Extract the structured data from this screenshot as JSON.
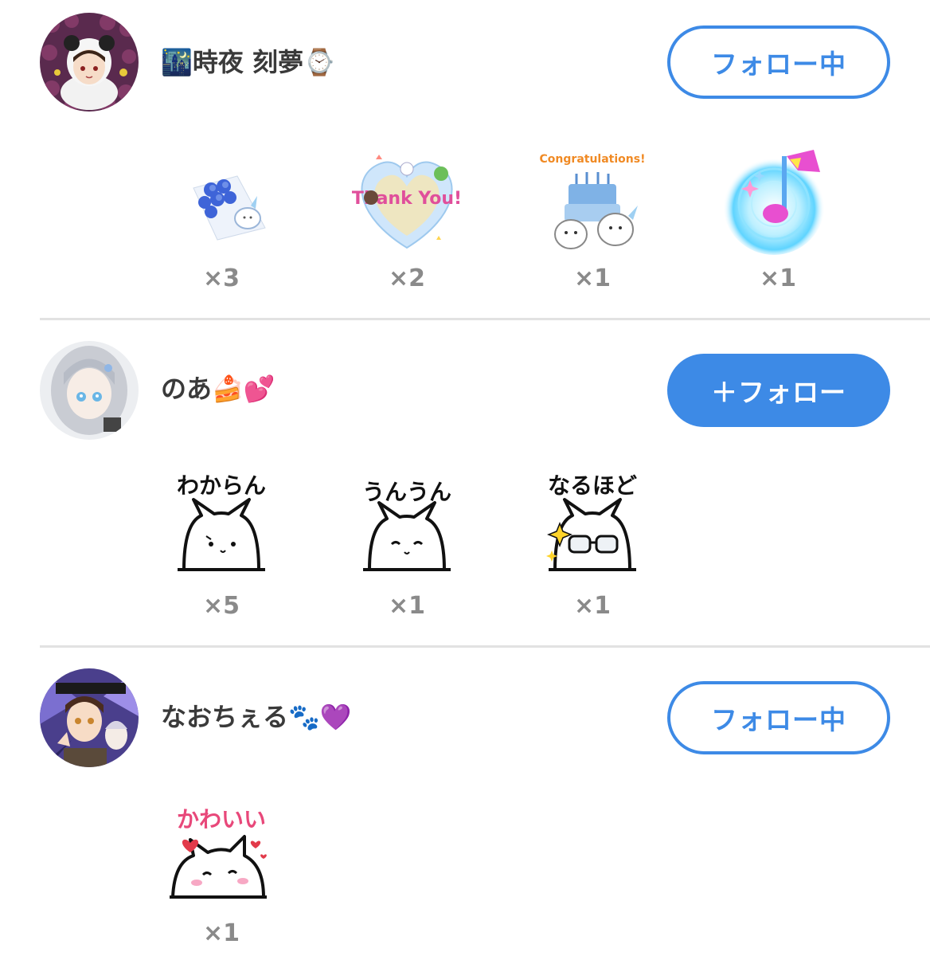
{
  "users": [
    {
      "name": "🌃時夜 刻夢⌚",
      "button": "フォロー中",
      "button_state": "following",
      "gifts": [
        {
          "icon": "blue-bouquet-icon",
          "count": "×3"
        },
        {
          "icon": "thank-you-heart-icon",
          "text": "Thank You!",
          "count": "×2"
        },
        {
          "icon": "congratulations-cake-icon",
          "text": "Congratulations!",
          "count": "×1"
        },
        {
          "icon": "music-note-icon",
          "count": "×1"
        }
      ]
    },
    {
      "name": "のあ🍰💕",
      "button": "＋フォロー",
      "button_state": "not-following",
      "gifts": [
        {
          "icon": "cat-sticker-icon",
          "text": "わからん",
          "count": "×5"
        },
        {
          "icon": "cat-sticker-icon",
          "text": "うんうん",
          "count": "×1"
        },
        {
          "icon": "cat-glasses-sticker-icon",
          "text": "なるほど",
          "count": "×1"
        }
      ]
    },
    {
      "name": "なおちぇる🐾💜",
      "button": "フォロー中",
      "button_state": "following",
      "gifts": [
        {
          "icon": "cat-hearts-sticker-icon",
          "text": "かわいい",
          "count": "×1"
        }
      ]
    }
  ],
  "colors": {
    "accent": "#3d8ae6",
    "count_text": "#8a8a8a",
    "divider": "#e2e2e2"
  }
}
